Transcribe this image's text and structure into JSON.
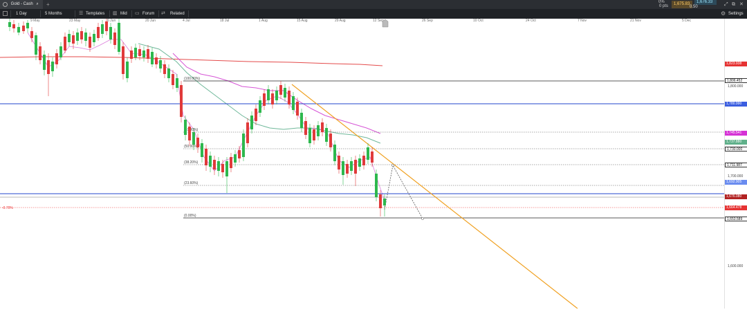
{
  "topbar": {
    "tab_title": "Gold - Cash",
    "change_percent": "0%",
    "change_pts": "0 pts",
    "bid": "1,675.83",
    "ask": "1,676.33",
    "spread": "0.50"
  },
  "toolbar": {
    "interval": "1 Day",
    "range": "5 Months",
    "templates": "Templates",
    "mid": "Mid",
    "forum": "Forum",
    "related": "Related",
    "settings": "Settings"
  },
  "chart": {
    "date_labels": [
      "9 May",
      "23 May",
      "6 Jun",
      "20 Jun",
      "4 Jul",
      "18 Jul",
      "1 Aug",
      "15 Aug",
      "29 Aug",
      "12 Sep",
      "26 Sep",
      "10 Oct",
      "24 Oct",
      "7 Nov",
      "21 Nov",
      "5 Dec"
    ],
    "price_ticks": [
      "1,800.000",
      "1,700.000",
      "1,600.000"
    ],
    "price_badges": [
      {
        "value": "1,823.938",
        "color": "#e63333"
      },
      {
        "value": "1,806.452",
        "color": "#ffffff"
      },
      {
        "value": "1,780.990",
        "color": "#3b5ee0"
      },
      {
        "value": "1,745.541",
        "color": "#d532d5"
      },
      {
        "value": "1,737.880",
        "color": "#5fb08a"
      },
      {
        "value": "1,730.000",
        "color": "#ffffff"
      },
      {
        "value": "1,711.987",
        "color": "#ffffff"
      },
      {
        "value": "1,692.905",
        "color": "#6a8cf0"
      },
      {
        "value": "1,676.080",
        "color": "#b22222"
      },
      {
        "value": "1,664.478",
        "color": "#e63333"
      },
      {
        "value": "1,653.589",
        "color": "#ffffff"
      }
    ],
    "fib_levels": [
      "(100.00%)",
      "(61.80%)",
      "(50.00%)",
      "(38.20%)",
      "(23.60%)",
      "(0.00%)"
    ],
    "pct_label": "-0.70%"
  }
}
